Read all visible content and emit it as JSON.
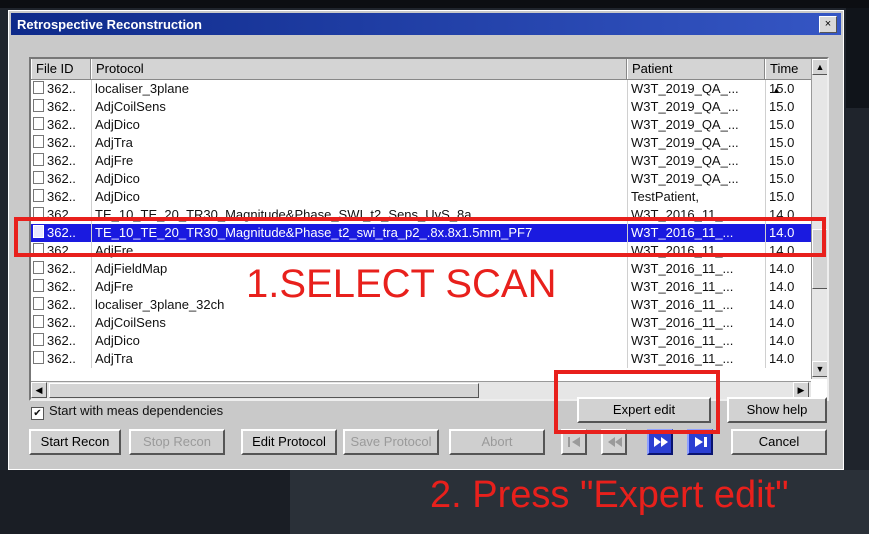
{
  "window": {
    "title": "Retrospective Reconstruction",
    "close_glyph": "×"
  },
  "table": {
    "headers": [
      "File ID",
      "Protocol",
      "Patient",
      "Time"
    ],
    "sort_glyph": "▲",
    "rows": [
      {
        "id": "362..",
        "protocol": "localiser_3plane",
        "patient": "W3T_2019_QA_...",
        "time": "15.0"
      },
      {
        "id": "362..",
        "protocol": "AdjCoilSens",
        "patient": "W3T_2019_QA_...",
        "time": "15.0"
      },
      {
        "id": "362..",
        "protocol": "AdjDico",
        "patient": "W3T_2019_QA_...",
        "time": "15.0"
      },
      {
        "id": "362..",
        "protocol": "AdjTra",
        "patient": "W3T_2019_QA_...",
        "time": "15.0"
      },
      {
        "id": "362..",
        "protocol": "AdjFre",
        "patient": "W3T_2019_QA_...",
        "time": "15.0"
      },
      {
        "id": "362..",
        "protocol": "AdjDico",
        "patient": "W3T_2019_QA_...",
        "time": "15.0"
      },
      {
        "id": "362..",
        "protocol": "AdjDico",
        "patient": "TestPatient,",
        "time": "15.0"
      },
      {
        "id": "362..",
        "protocol": "TE_10_TE_20_TR30_Magnitude&Phase_SWI_t2_Sens_UvS_8a...",
        "patient": "W3T_2016_11_...",
        "time": "14.0"
      },
      {
        "id": "362..",
        "protocol": "TE_10_TE_20_TR30_Magnitude&Phase_t2_swi_tra_p2_.8x.8x1.5mm_PF7",
        "patient": "W3T_2016_11_...",
        "time": "14.0",
        "selected": true
      },
      {
        "id": "362..",
        "protocol": "AdjFre",
        "patient": "W3T_2016_11_...",
        "time": "14.0"
      },
      {
        "id": "362..",
        "protocol": "AdjFieldMap",
        "patient": "W3T_2016_11_...",
        "time": "14.0"
      },
      {
        "id": "362..",
        "protocol": "AdjFre",
        "patient": "W3T_2016_11_...",
        "time": "14.0"
      },
      {
        "id": "362..",
        "protocol": "localiser_3plane_32ch",
        "patient": "W3T_2016_11_...",
        "time": "14.0"
      },
      {
        "id": "362..",
        "protocol": "AdjCoilSens",
        "patient": "W3T_2016_11_...",
        "time": "14.0"
      },
      {
        "id": "362..",
        "protocol": "AdjDico",
        "patient": "W3T_2016_11_...",
        "time": "14.0"
      },
      {
        "id": "362..",
        "protocol": "AdjTra",
        "patient": "W3T_2016_11_...",
        "time": "14.0"
      }
    ]
  },
  "options": {
    "start_with_meas_dependencies": "Start with meas dependencies",
    "checked_glyph": "✔"
  },
  "buttons": {
    "expert_edit": "Expert edit",
    "show_help": "Show help",
    "start_recon": "Start Recon",
    "stop_recon": "Stop Recon",
    "edit_protocol": "Edit Protocol",
    "save_protocol": "Save Protocol",
    "abort": "Abort",
    "cancel": "Cancel"
  },
  "annotations": {
    "step1": "1.SELECT SCAN",
    "step2": "2. Press \"Expert edit\"",
    "color": "#e8201c"
  },
  "colors": {
    "selection": "#1a1ae0",
    "title_bar": "#0e2a8a",
    "nav_active": "#2b3fd2"
  },
  "icons": [
    "close-icon",
    "document-icon",
    "checkbox-icon",
    "first-icon",
    "prev-icon",
    "next-icon",
    "last-icon"
  ]
}
